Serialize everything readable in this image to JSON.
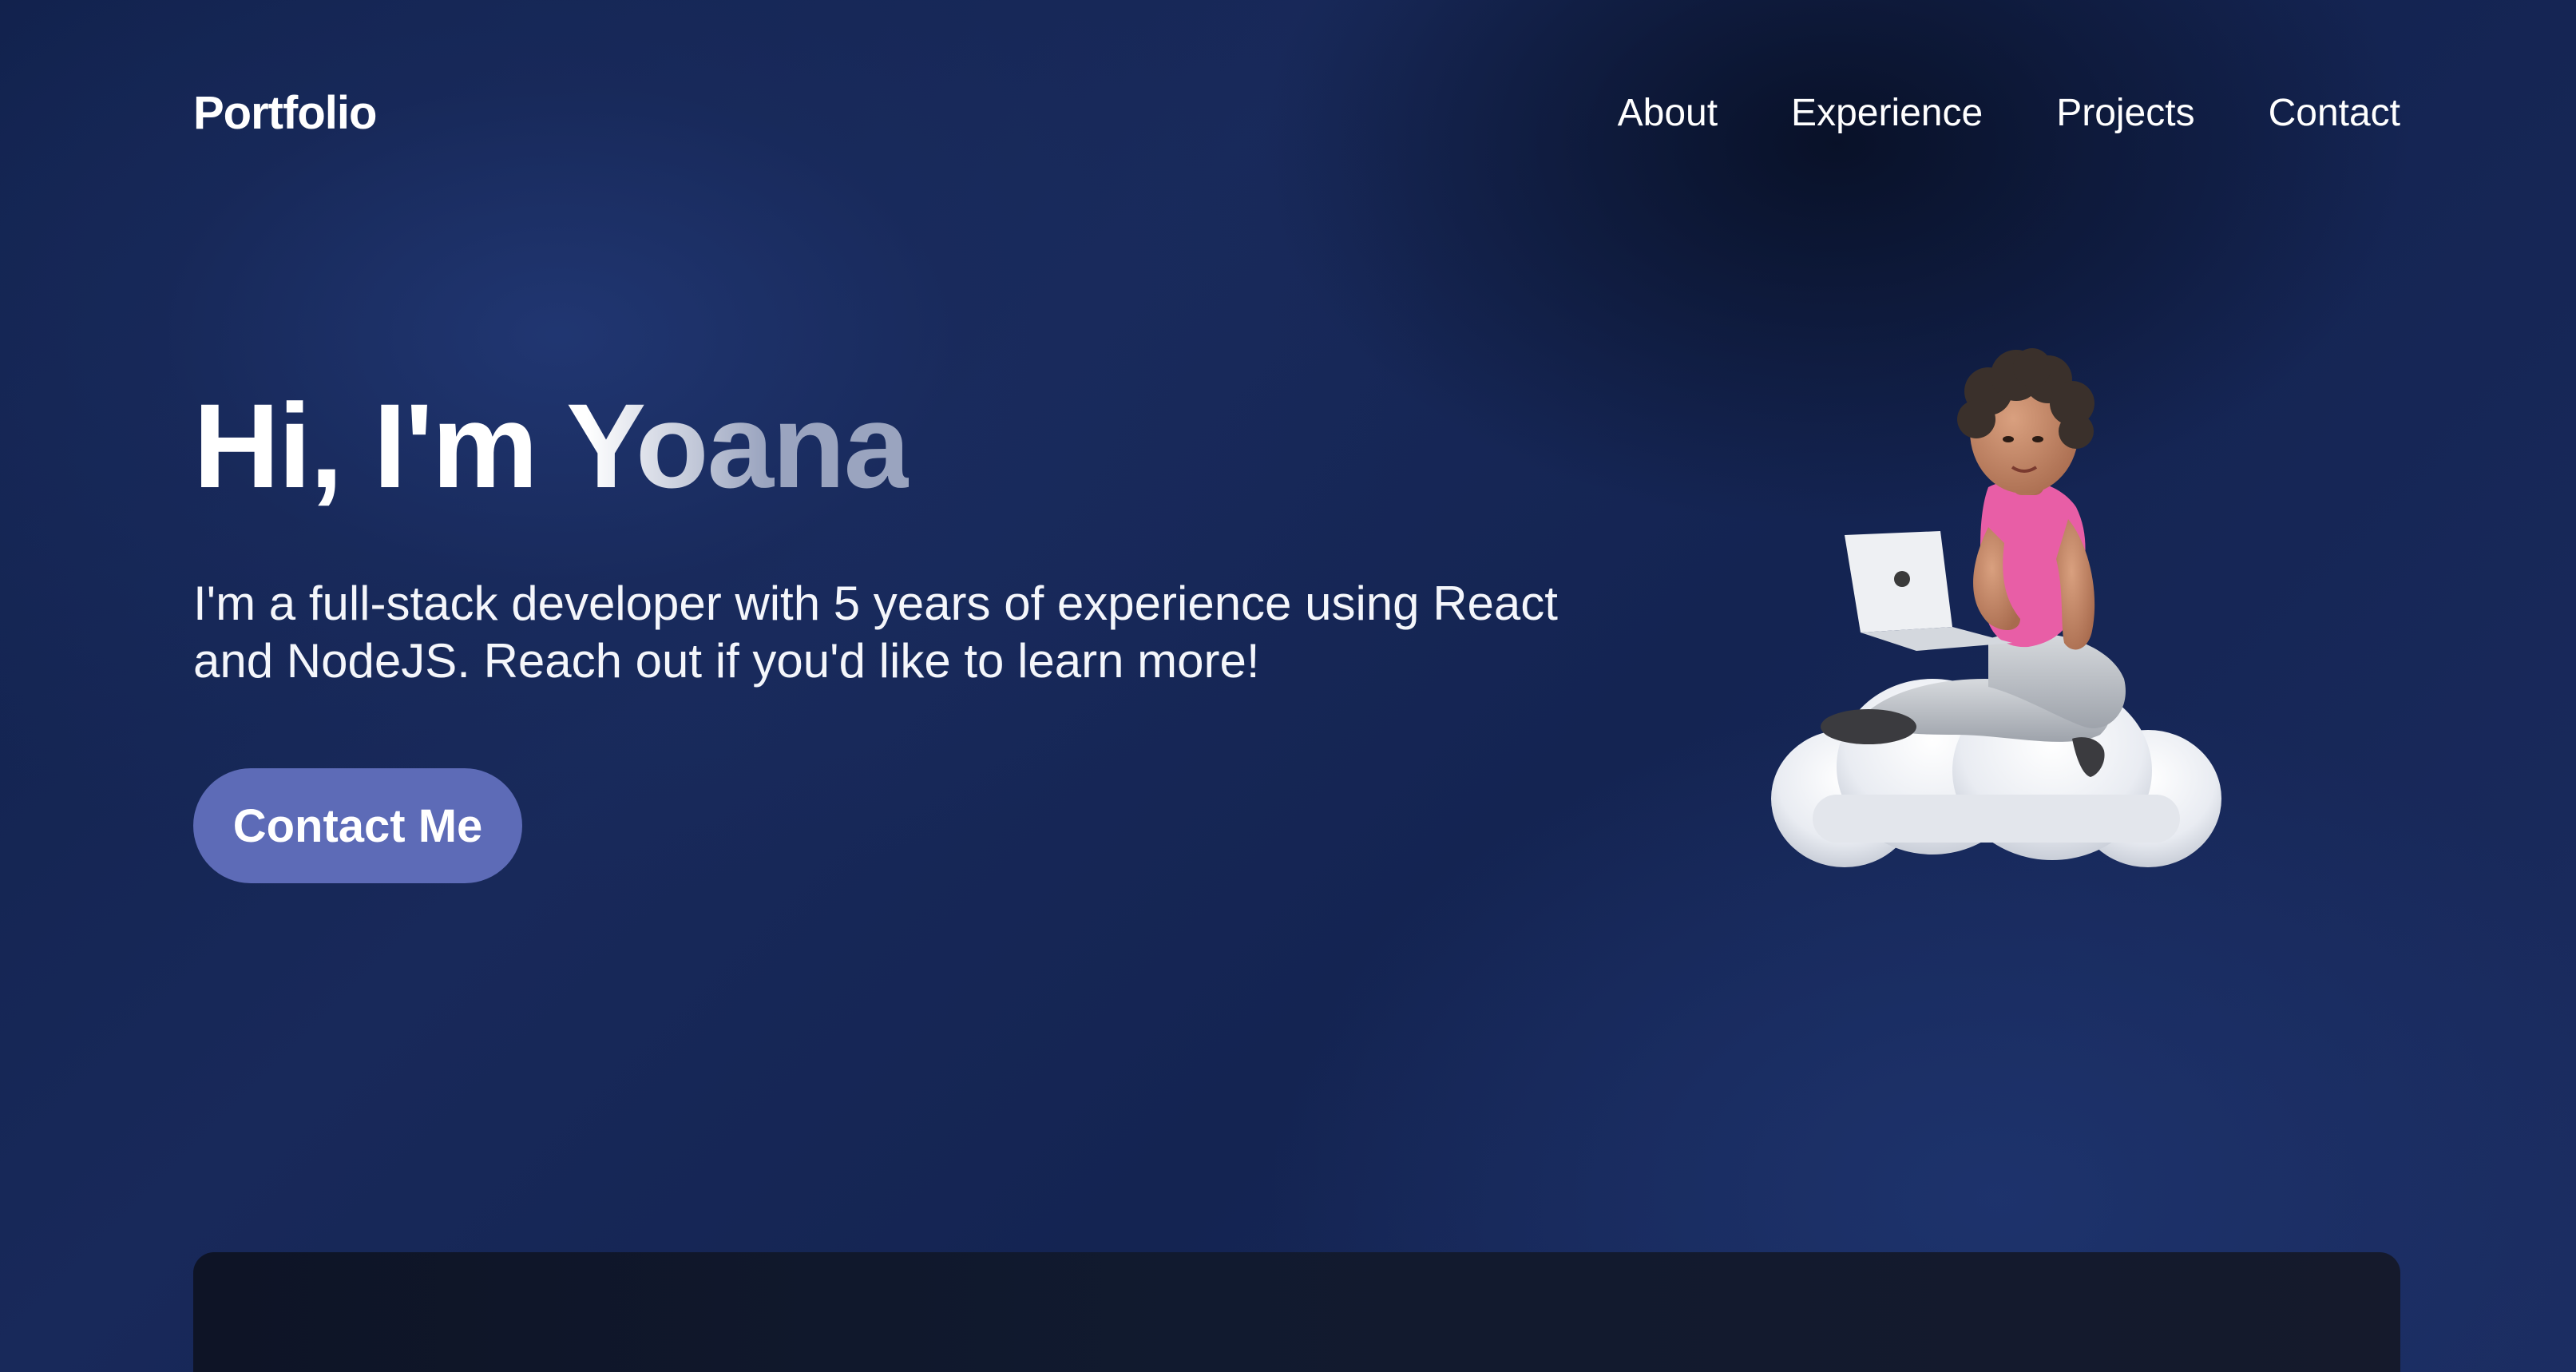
{
  "header": {
    "logo": "Portfolio",
    "nav": [
      {
        "label": "About"
      },
      {
        "label": "Experience"
      },
      {
        "label": "Projects"
      },
      {
        "label": "Contact"
      }
    ]
  },
  "hero": {
    "title": "Hi, I'm Yoana",
    "description": "I'm a full-stack developer with 5 years of experience using React and NodeJS. Reach out if you'd like to learn more!",
    "cta_label": "Contact Me",
    "image_icon": "developer-on-cloud-illustration"
  },
  "colors": {
    "background": "#172a5c",
    "button": "#5d6bb7",
    "text": "#ffffff",
    "card": "#111a2f"
  }
}
